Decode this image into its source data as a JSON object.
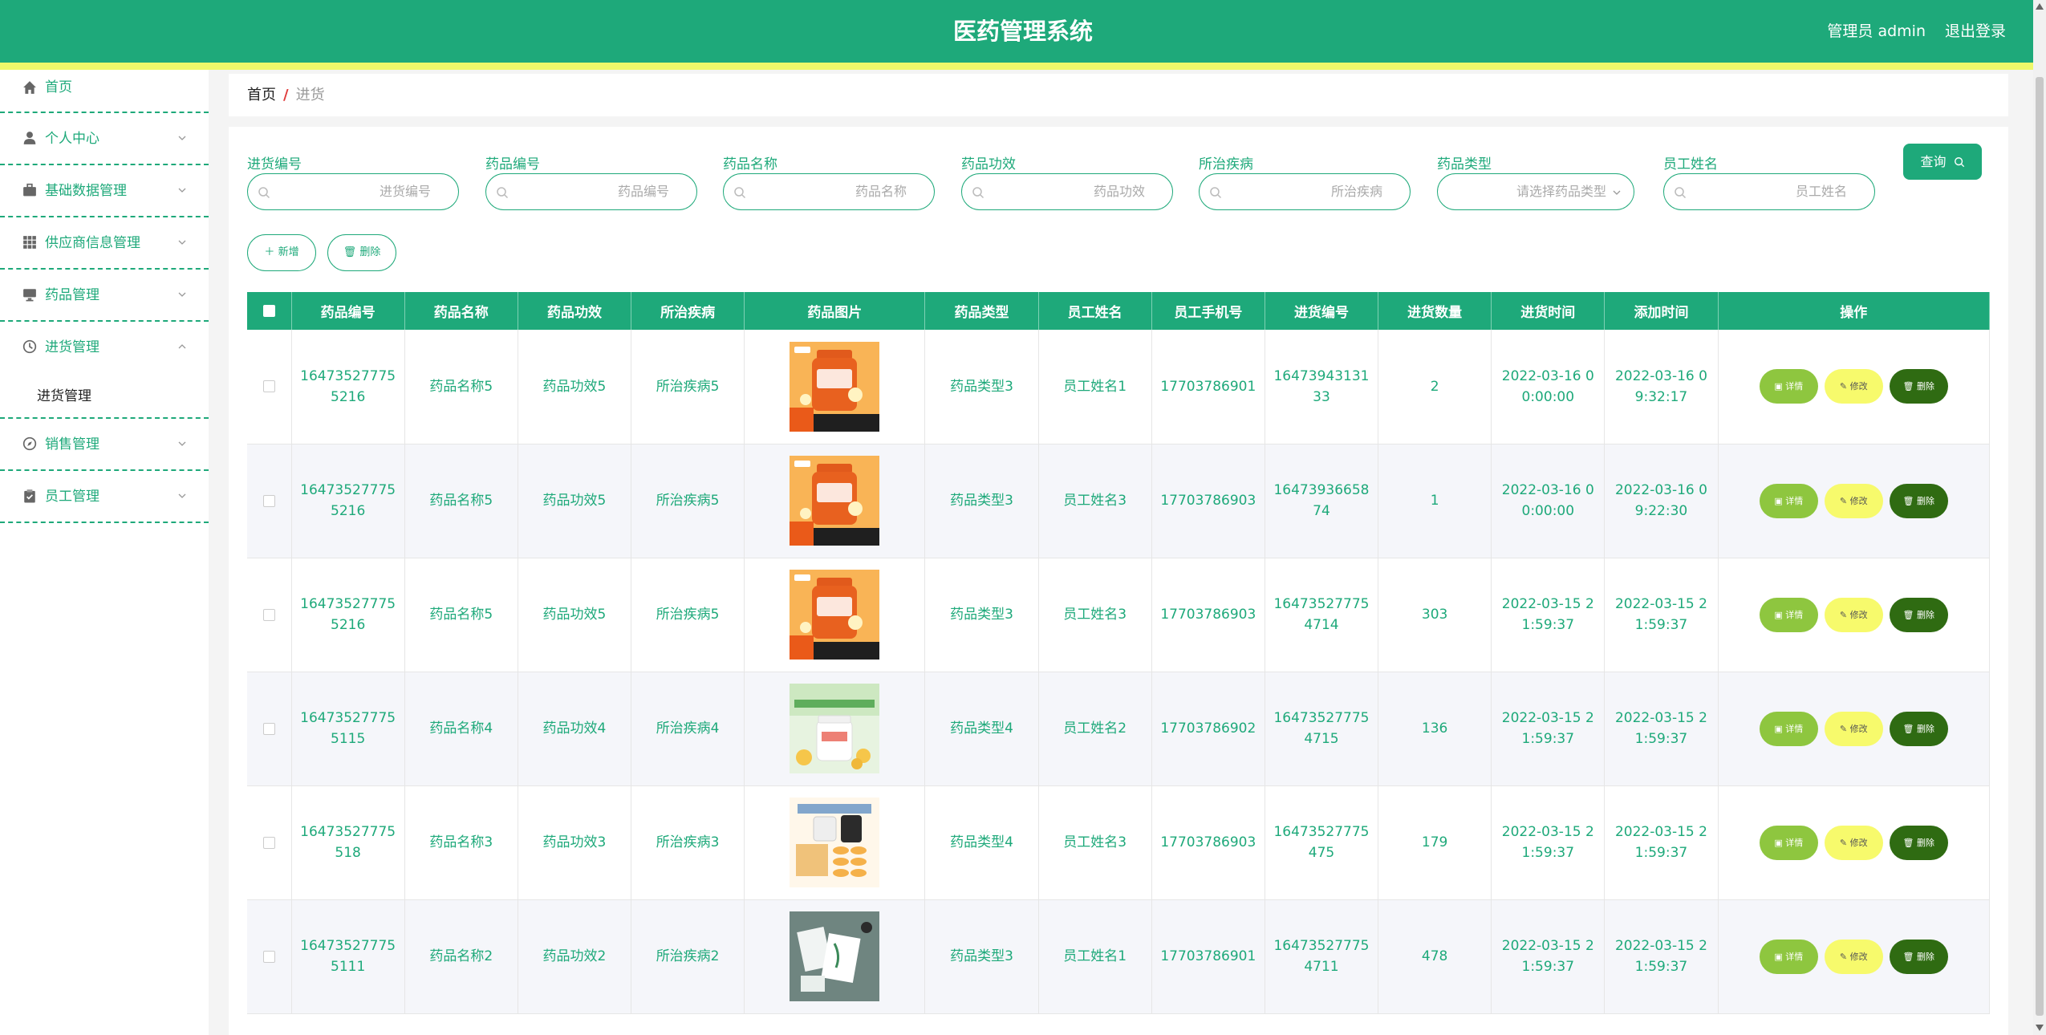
{
  "header": {
    "title": "医药管理系统",
    "user": "管理员 admin",
    "logout": "退出登录"
  },
  "sidebar": {
    "home": "首页",
    "items": [
      {
        "label": "个人中心",
        "icon": "user-icon"
      },
      {
        "label": "基础数据管理",
        "icon": "briefcase-icon"
      },
      {
        "label": "供应商信息管理",
        "icon": "grid-icon"
      },
      {
        "label": "药品管理",
        "icon": "monitor-icon"
      },
      {
        "label": "进货管理",
        "icon": "clock-icon",
        "expanded": true,
        "sub": "进货管理"
      },
      {
        "label": "销售管理",
        "icon": "compass-icon"
      },
      {
        "label": "员工管理",
        "icon": "clipboard-icon"
      }
    ]
  },
  "breadcrumb": {
    "home": "首页",
    "sep": "/",
    "current": "进货"
  },
  "filters": [
    {
      "label": "进货编号",
      "placeholder": "进货编号",
      "type": "search"
    },
    {
      "label": "药品编号",
      "placeholder": "药品编号",
      "type": "search"
    },
    {
      "label": "药品名称",
      "placeholder": "药品名称",
      "type": "search"
    },
    {
      "label": "药品功效",
      "placeholder": "药品功效",
      "type": "search"
    },
    {
      "label": "所治疾病",
      "placeholder": "所治疾病",
      "type": "search"
    },
    {
      "label": "药品类型",
      "placeholder": "请选择药品类型",
      "type": "select"
    },
    {
      "label": "员工姓名",
      "placeholder": "员工姓名",
      "type": "search"
    }
  ],
  "actions": {
    "query": "查询",
    "add": "新增",
    "delete": "删除"
  },
  "table": {
    "columns": [
      "药品编号",
      "药品名称",
      "药品功效",
      "所治疾病",
      "药品图片",
      "药品类型",
      "员工姓名",
      "员工手机号",
      "进货编号",
      "进货数量",
      "进货时间",
      "添加时间",
      "操作"
    ],
    "ops": {
      "detail": "详情",
      "edit": "修改",
      "delete": "删除"
    },
    "rows": [
      {
        "drug_id": "164735277755216",
        "name": "药品名称5",
        "effect": "药品功效5",
        "disease": "所治疾病5",
        "image": "orange-bottle",
        "type": "药品类型3",
        "staff": "员工姓名1",
        "phone": "17703786901",
        "purchase_id": "1647394313133",
        "qty": "2",
        "purchase_time": "2022-03-16 00:00:00",
        "add_time": "2022-03-16 09:32:17"
      },
      {
        "drug_id": "164735277755216",
        "name": "药品名称5",
        "effect": "药品功效5",
        "disease": "所治疾病5",
        "image": "orange-bottle",
        "type": "药品类型3",
        "staff": "员工姓名3",
        "phone": "17703786903",
        "purchase_id": "1647393665874",
        "qty": "1",
        "purchase_time": "2022-03-16 00:00:00",
        "add_time": "2022-03-16 09:22:30"
      },
      {
        "drug_id": "164735277755216",
        "name": "药品名称5",
        "effect": "药品功效5",
        "disease": "所治疾病5",
        "image": "orange-bottle",
        "type": "药品类型3",
        "staff": "员工姓名3",
        "phone": "17703786903",
        "purchase_id": "164735277754714",
        "qty": "303",
        "purchase_time": "2022-03-15 21:59:37",
        "add_time": "2022-03-15 21:59:37"
      },
      {
        "drug_id": "164735277755115",
        "name": "药品名称4",
        "effect": "药品功效4",
        "disease": "所治疾病4",
        "image": "white-bottle",
        "type": "药品类型4",
        "staff": "员工姓名2",
        "phone": "17703786902",
        "purchase_id": "164735277754715",
        "qty": "136",
        "purchase_time": "2022-03-15 21:59:37",
        "add_time": "2022-03-15 21:59:37"
      },
      {
        "drug_id": "16473527775518",
        "name": "药品名称3",
        "effect": "药品功效3",
        "disease": "所治疾病3",
        "image": "capsule-box",
        "type": "药品类型4",
        "staff": "员工姓名3",
        "phone": "17703786903",
        "purchase_id": "16473527775475",
        "qty": "179",
        "purchase_time": "2022-03-15 21:59:37",
        "add_time": "2022-03-15 21:59:37"
      },
      {
        "drug_id": "164735277755111",
        "name": "药品名称2",
        "effect": "药品功效2",
        "disease": "所治疾病2",
        "image": "green-package",
        "type": "药品类型3",
        "staff": "员工姓名1",
        "phone": "17703786901",
        "purchase_id": "164735277754711",
        "qty": "478",
        "purchase_time": "2022-03-15 21:59:37",
        "add_time": "2022-03-15 21:59:37"
      }
    ]
  },
  "colors": {
    "primary": "#1ea97a",
    "accent_strip": "#eef86a",
    "detail": "#8ec63f",
    "edit": "#f7fa6c",
    "delete": "#2f6b12"
  }
}
